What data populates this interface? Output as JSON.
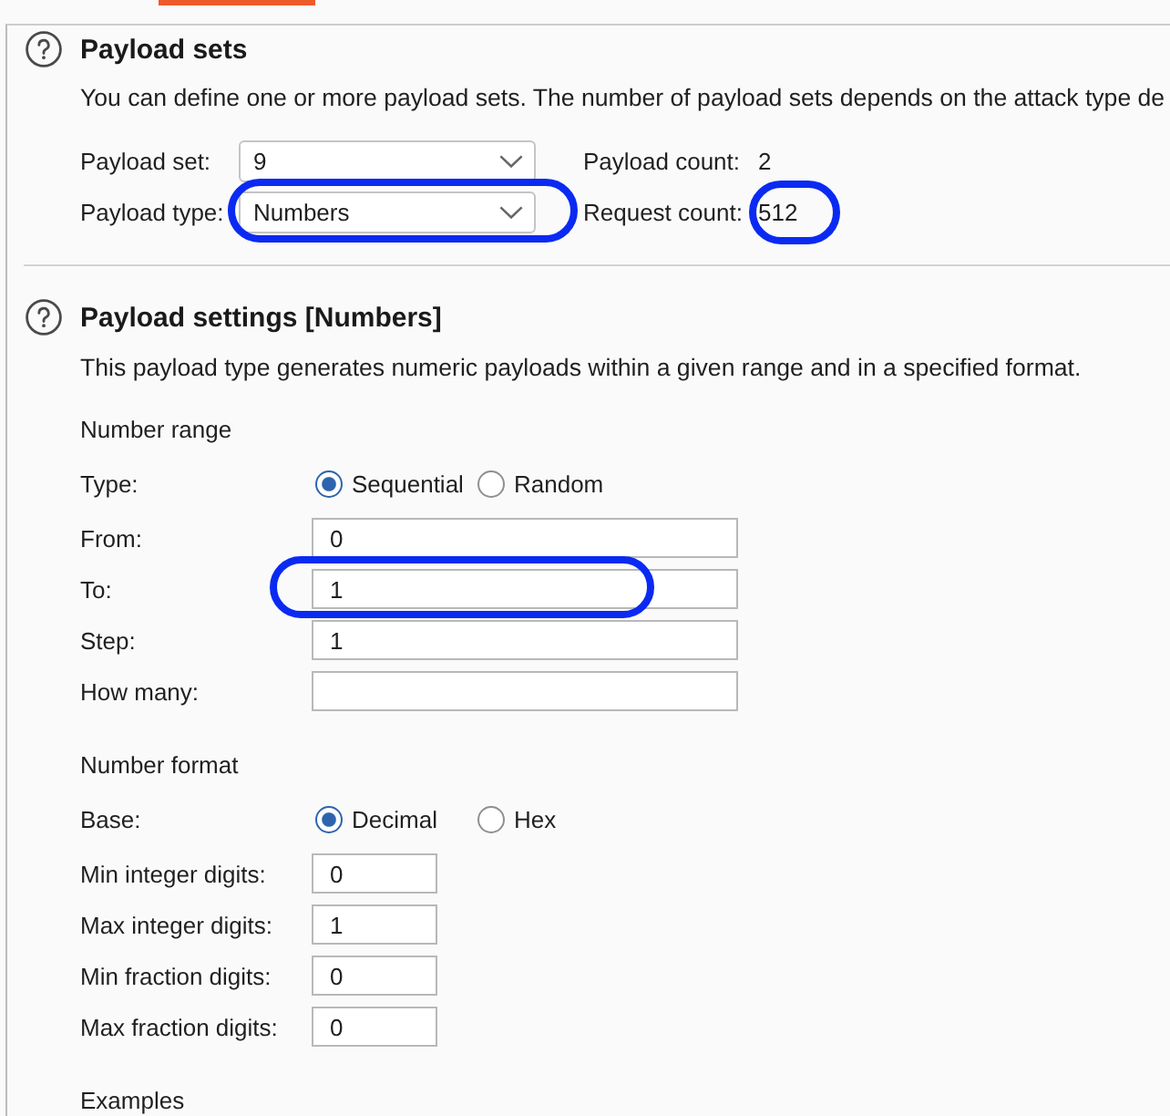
{
  "payload_sets": {
    "title": "Payload sets",
    "description": "You can define one or more payload sets. The number of payload sets depends on the attack type de",
    "selectors": [
      {
        "label": "Payload set:",
        "value": "9",
        "highlighted": false
      },
      {
        "label": "Payload type:",
        "value": "Numbers",
        "highlighted": true
      }
    ],
    "counts": [
      {
        "label": "Payload count:",
        "value": "2",
        "highlighted": false
      },
      {
        "label": "Request count:",
        "value": "512",
        "highlighted": true
      }
    ]
  },
  "payload_settings": {
    "title": "Payload settings [Numbers]",
    "description": "This payload type generates numeric payloads within a given range and in a specified format.",
    "groups": [
      {
        "heading": "Number range",
        "rows": [
          {
            "kind": "radio",
            "label": "Type:",
            "highlighted": false,
            "options": [
              {
                "label": "Sequential",
                "selected": true
              },
              {
                "label": "Random",
                "selected": false
              }
            ]
          },
          {
            "kind": "text_field",
            "label": "From:",
            "value": "0",
            "highlighted": false
          },
          {
            "kind": "text_field",
            "label": "To:",
            "value": "1",
            "highlighted": true
          },
          {
            "kind": "text_field",
            "label": "Step:",
            "value": "1",
            "highlighted": false
          },
          {
            "kind": "text_field",
            "label": "How many:",
            "highlighted": false
          }
        ]
      },
      {
        "heading": "Number format",
        "rows": [
          {
            "kind": "radio",
            "label": "Base:",
            "highlighted": false,
            "options": [
              {
                "label": "Decimal",
                "selected": true
              },
              {
                "label": "Hex",
                "selected": false
              }
            ]
          },
          {
            "kind": "digits_field",
            "label": "Min integer digits:",
            "value": "0",
            "highlighted": false
          },
          {
            "kind": "digits_field",
            "label": "Max integer digits:",
            "value": "1",
            "highlighted": false
          },
          {
            "kind": "digits_field",
            "label": "Min fraction digits:",
            "value": "0",
            "highlighted": false
          },
          {
            "kind": "digits_field",
            "label": "Max fraction digits:",
            "value": "0",
            "highlighted": false
          }
        ]
      },
      {
        "heading": "Examples"
      }
    ]
  }
}
